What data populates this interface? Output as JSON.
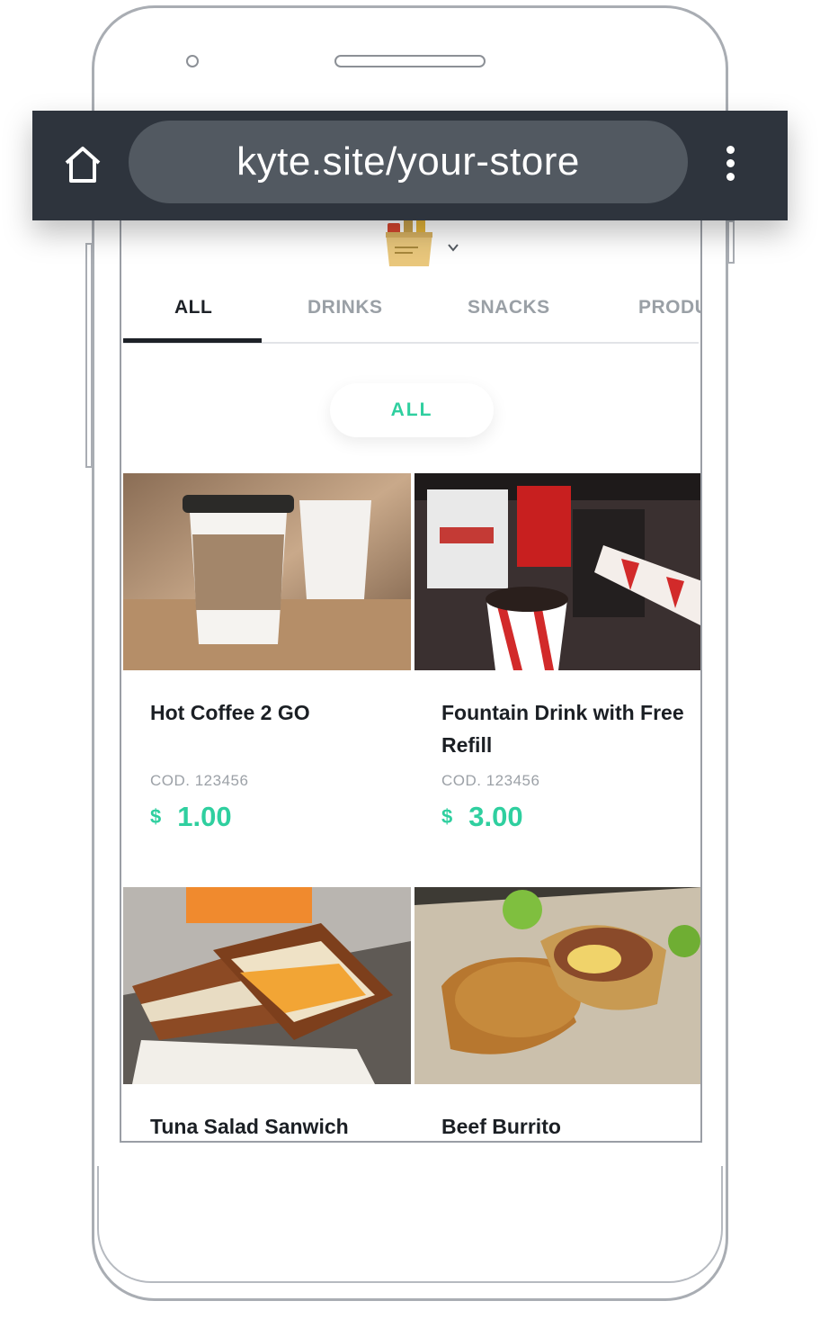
{
  "browser": {
    "url": "kyte.site/your-store",
    "home_icon": "home-icon",
    "menu_icon": "more-vertical-icon"
  },
  "store": {
    "logo_icon": "grocery-bag-icon",
    "dropdown_icon": "chevron-down-icon"
  },
  "tabs": [
    {
      "label": "ALL",
      "active": true
    },
    {
      "label": "DRINKS",
      "active": false
    },
    {
      "label": "SNACKS",
      "active": false
    },
    {
      "label": "PRODU",
      "active": false
    }
  ],
  "category_chip": {
    "label": "ALL"
  },
  "products": [
    {
      "name": "Hot Coffee 2 GO",
      "code": "COD. 123456",
      "currency": "$",
      "price": "1.00"
    },
    {
      "name": "Fountain Drink with Free Refill",
      "code": "COD. 123456",
      "currency": "$",
      "price": "3.00"
    },
    {
      "name": "Tuna Salad Sanwich"
    },
    {
      "name": "Beef Burrito"
    }
  ],
  "colors": {
    "accent": "#2fcf9f",
    "browser_bar": "#2e343d",
    "url_pill": "#525961",
    "text_dark": "#1b1f24",
    "text_muted": "#9ca1a7"
  }
}
